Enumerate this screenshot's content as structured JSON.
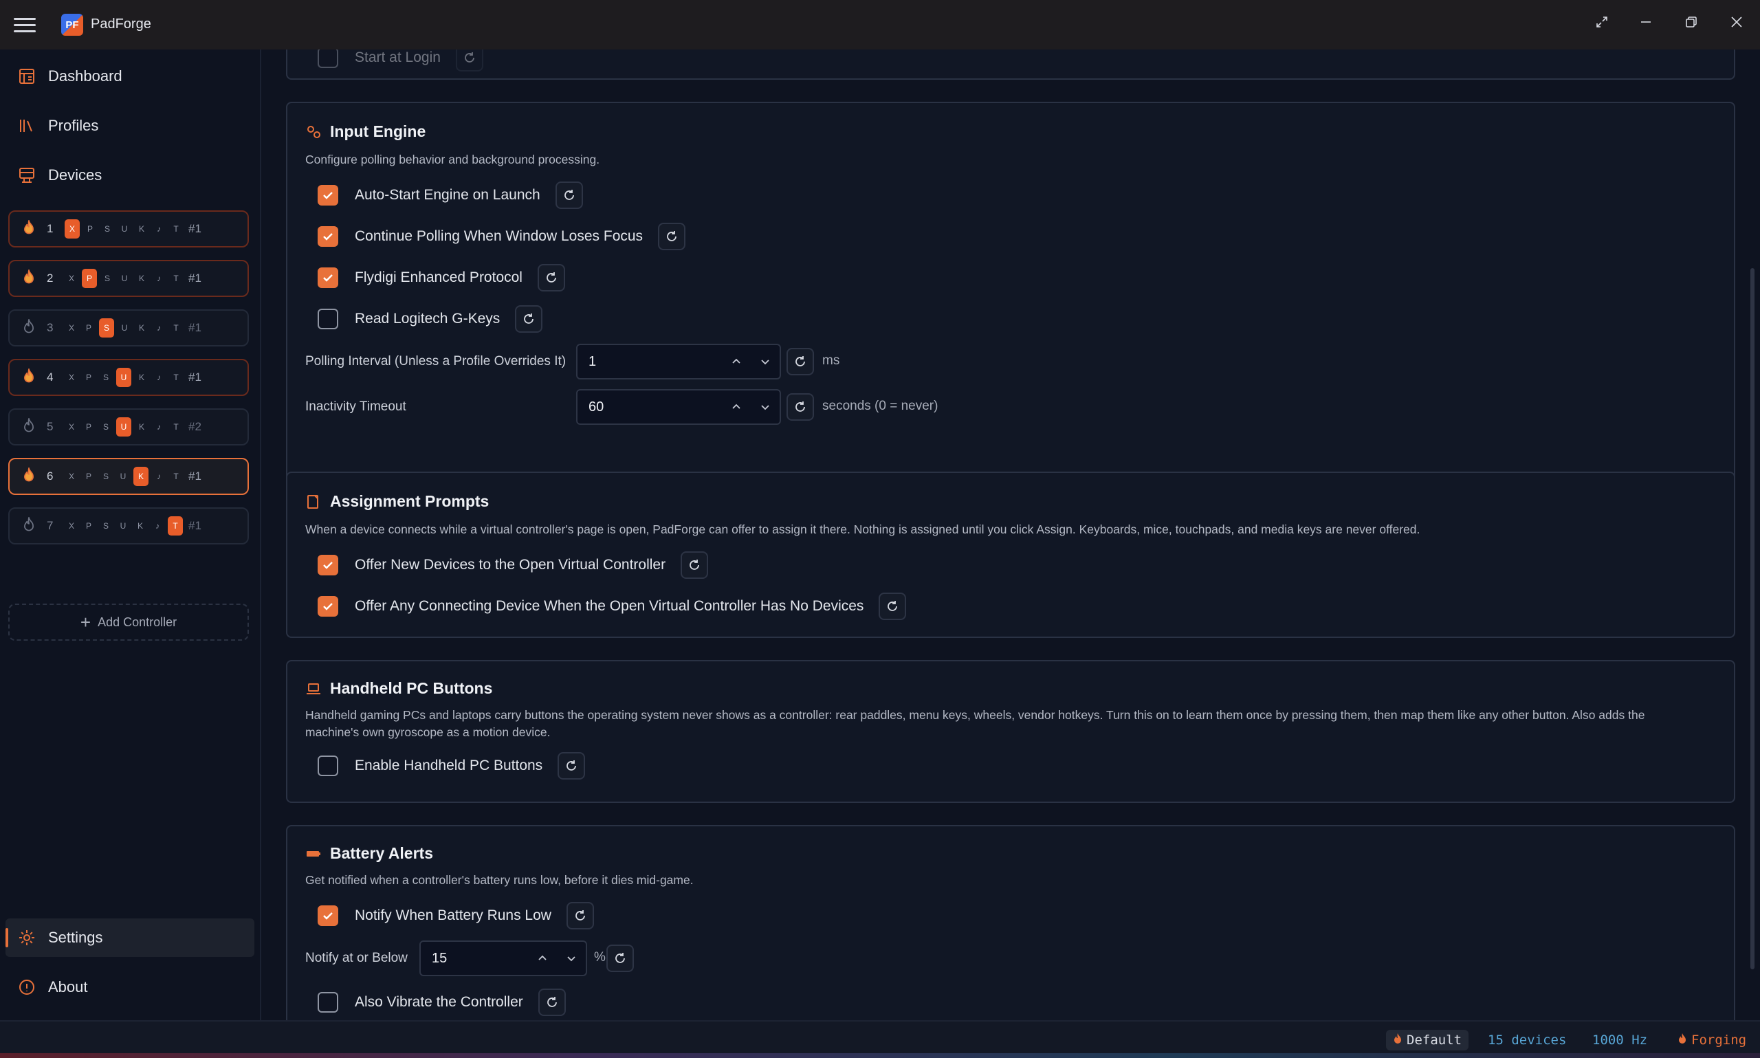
{
  "window": {
    "app_title": "PadForge",
    "logo_text": "PF"
  },
  "sidebar": {
    "nav": [
      {
        "label": "Dashboard",
        "icon": "dashboard-icon"
      },
      {
        "label": "Profiles",
        "icon": "profiles-icon"
      },
      {
        "label": "Devices",
        "icon": "devices-icon"
      }
    ],
    "controllers": [
      {
        "slot": "1",
        "index": "#1",
        "active_type": "xbox",
        "state": "active"
      },
      {
        "slot": "2",
        "index": "#1",
        "active_type": "playstation",
        "state": "active"
      },
      {
        "slot": "3",
        "index": "#1",
        "active_type": "switch",
        "state": "inactive"
      },
      {
        "slot": "4",
        "index": "#1",
        "active_type": "user",
        "state": "active"
      },
      {
        "slot": "5",
        "index": "#2",
        "active_type": "user",
        "state": "inactive"
      },
      {
        "slot": "6",
        "index": "#1",
        "active_type": "keyboard",
        "state": "selected"
      },
      {
        "slot": "7",
        "index": "#1",
        "active_type": "touchpad",
        "state": "inactive"
      }
    ],
    "add_controller": "Add Controller",
    "bottom_nav": [
      {
        "label": "Settings",
        "icon": "gear-icon",
        "active": true
      },
      {
        "label": "About",
        "icon": "info-icon",
        "active": false
      }
    ]
  },
  "partial_top": {
    "label": "Start at Login"
  },
  "input_engine": {
    "title": "Input Engine",
    "description": "Configure polling behavior and background processing.",
    "options": [
      {
        "label": "Auto-Start Engine on Launch",
        "checked": true
      },
      {
        "label": "Continue Polling When Window Loses Focus",
        "checked": true
      },
      {
        "label": "Flydigi Enhanced Protocol",
        "checked": true
      },
      {
        "label": "Read Logitech G-Keys",
        "checked": false
      }
    ],
    "polling_label": "Polling Interval (Unless a Profile Overrides It)",
    "polling_value": "1",
    "polling_unit": "ms",
    "inactivity_label": "Inactivity Timeout",
    "inactivity_value": "60",
    "inactivity_unit": "seconds (0 = never)"
  },
  "assignment": {
    "title": "Assignment Prompts",
    "description": "When a device connects while a virtual controller's page is open, PadForge can offer to assign it there. Nothing is assigned until you click Assign. Keyboards, mice, touchpads, and media keys are never offered.",
    "options": [
      {
        "label": "Offer New Devices to the Open Virtual Controller",
        "checked": true
      },
      {
        "label": "Offer Any Connecting Device When the Open Virtual Controller Has No Devices",
        "checked": true
      }
    ]
  },
  "handheld": {
    "title": "Handheld PC Buttons",
    "description": "Handheld gaming PCs and laptops carry buttons the operating system never shows as a controller: rear paddles, menu keys, wheels, vendor hotkeys. Turn this on to learn them once by pressing them, then map them like any other button. Also adds the machine's own gyroscope as a motion device.",
    "options": [
      {
        "label": "Enable Handheld PC Buttons",
        "checked": false
      }
    ]
  },
  "battery": {
    "title": "Battery Alerts",
    "description": "Get notified when a controller's battery runs low, before it dies mid-game.",
    "notify_label": "Notify When Battery Runs Low",
    "notify_checked": true,
    "threshold_label": "Notify at or Below",
    "threshold_value": "15",
    "threshold_unit": "%",
    "vibrate_label": "Also Vibrate the Controller",
    "vibrate_checked": false
  },
  "status": {
    "profile": "Default",
    "devices": "15 devices",
    "rate": "1000 Hz",
    "state": "Forging"
  },
  "colors": {
    "accent": "#e8713a",
    "background": "#0e1320",
    "card": "#111725",
    "status_blue": "#58a6d6"
  }
}
